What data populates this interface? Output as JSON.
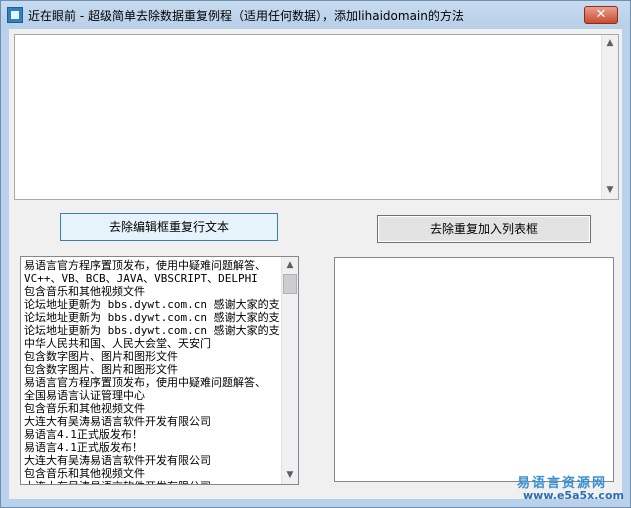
{
  "window": {
    "title": "近在眼前 - 超级简单去除数据重复例程（适用任何数据），添加lihaidomain的方法",
    "close_glyph": "✕"
  },
  "buttons": {
    "remove_edit_dup": "去除编辑框重复行文本",
    "remove_list_dup": "去除重复加入列表框"
  },
  "list": {
    "items": [
      "易语言官方程序置顶发布，使用中疑难问题解答、",
      "VC++、VB、BCB、JAVA、VBSCRIPT、DELPHI",
      "包含音乐和其他视频文件",
      "论坛地址更新为 bbs.dywt.com.cn 感谢大家的支",
      "论坛地址更新为 bbs.dywt.com.cn 感谢大家的支",
      "论坛地址更新为 bbs.dywt.com.cn 感谢大家的支",
      "中华人民共和国、人民大会堂、天安门",
      "包含数字图片、图片和图形文件",
      "包含数字图片、图片和图形文件",
      "易语言官方程序置顶发布，使用中疑难问题解答、",
      "全国易语言认证管理中心",
      "包含音乐和其他视频文件",
      "大连大有吴涛易语言软件开发有限公司",
      "易语言4.1正式版发布！",
      "易语言4.1正式版发布！",
      "大连大有吴涛易语言软件开发有限公司",
      "包含音乐和其他视频文件",
      "大连大有吴涛易语言软件开发有限公司"
    ]
  },
  "watermark": {
    "line1": "易语言资源网",
    "line2": "www.e5a5x.com"
  },
  "icons": {
    "scroll_up": "▲",
    "scroll_down": "▼"
  }
}
